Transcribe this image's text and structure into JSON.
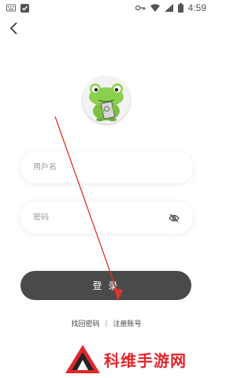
{
  "status_bar": {
    "time": "4:59",
    "left_icons": [
      "keyboard-icon",
      "shield-check-icon"
    ],
    "right_icons": [
      "key-icon",
      "wifi-icon",
      "signal-icon",
      "battery-icon"
    ]
  },
  "nav": {
    "back_icon": "chevron-left-icon"
  },
  "avatar": {
    "icon": "frog-mascot-icon"
  },
  "form": {
    "username_placeholder": "用戶名",
    "password_placeholder": "密码",
    "password_toggle_icon": "eye-off-icon",
    "login_label": "登 录"
  },
  "links": {
    "forgot": "找回密码",
    "separator": "|",
    "register": "注册账号"
  },
  "watermark": {
    "text": "科维手游网",
    "color": "#e2262b"
  },
  "colors": {
    "button_bg": "#4a4a4a",
    "annotation_arrow": "#d9352b"
  }
}
